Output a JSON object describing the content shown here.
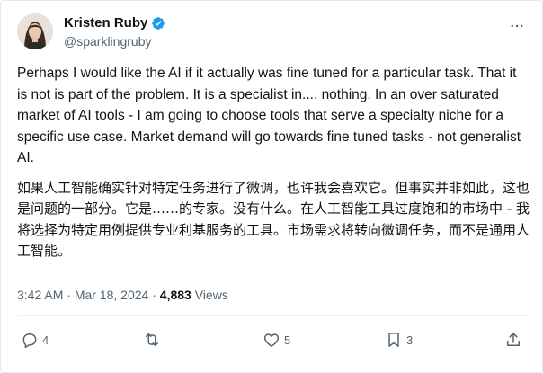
{
  "author": {
    "display_name": "Kristen Ruby",
    "handle": "@sparklingruby"
  },
  "tweet": {
    "english_text": "Perhaps I would like the AI if it actually was fine tuned for a particular task. That it is not is part of the problem. It is a specialist in.... nothing. In an over saturated market of AI tools - I am going to choose tools that serve a specialty niche for a specific use case. Market demand will go towards fine tuned tasks - not generalist AI.",
    "chinese_text": "如果人工智能确实针对特定任务进行了微调，也许我会喜欢它。但事实并非如此，这也是问题的一部分。它是……的专家。没有什么。在人工智能工具过度饱和的市场中 - 我将选择为特定用例提供专业利基服务的工具。市场需求将转向微调任务，而不是通用人工智能。"
  },
  "meta": {
    "time": "3:42 AM",
    "sep1": " · ",
    "date": "Mar 18, 2024",
    "sep2": " · ",
    "views_count": "4,883",
    "views_label": " Views"
  },
  "actions": {
    "reply_count": "4",
    "like_count": "5",
    "bookmark_count": "3"
  },
  "colors": {
    "text": "#0f1419",
    "secondary": "#536471",
    "verified": "#1d9bf0"
  },
  "icons": [
    "verified-badge-icon",
    "more-icon",
    "reply-icon",
    "retweet-icon",
    "like-icon",
    "bookmark-icon",
    "share-icon"
  ]
}
